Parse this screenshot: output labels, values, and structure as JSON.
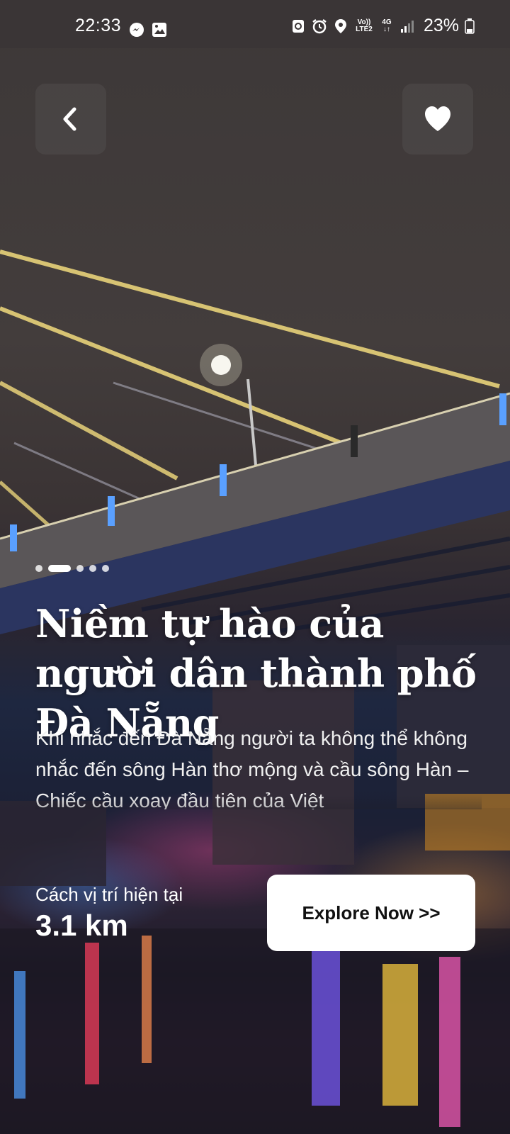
{
  "status_bar": {
    "time": "22:33",
    "left_icons": [
      "messenger-icon",
      "gallery-icon"
    ],
    "right_icons": [
      "recycle-icon",
      "alarm-icon",
      "location-icon",
      "volte-icon",
      "4g-icon",
      "signal-icon"
    ],
    "volte_label": "Vo))\nLTE2",
    "network_label": "4G",
    "battery": "23%"
  },
  "header": {
    "back_icon": "chevron-left-icon",
    "favorite_icon": "heart-icon"
  },
  "carousel": {
    "count": 5,
    "active_index": 1
  },
  "content": {
    "title": "Niềm tự hào của người dân thành phố Đà Nẵng",
    "description": "Khi nhắc đến Đà Nẵng người ta không thể không nhắc đến sông Hàn thơ mộng và cầu sông Hàn – Chiếc cầu xoay đầu tiên của Việt",
    "distance_label": "Cách vị trí hiện tại",
    "distance_value": "3.1 km"
  },
  "actions": {
    "explore_label": "Explore Now >>"
  },
  "colors": {
    "status_bar_bg": "#3a3536",
    "button_bg": "#ffffff",
    "text": "#ffffff"
  }
}
